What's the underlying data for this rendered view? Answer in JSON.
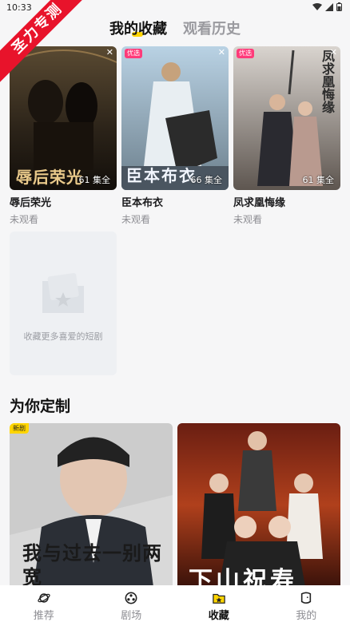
{
  "status": {
    "time": "10:33"
  },
  "ribbon": {
    "text": "圣力专测"
  },
  "tabs": [
    {
      "label": "我的收藏",
      "active": true
    },
    {
      "label": "观看历史",
      "active": false
    }
  ],
  "favorites": [
    {
      "title": "辱后荣光",
      "status": "未观看",
      "episodes": "61 集全",
      "badge": "",
      "poster_text": "辱后荣光"
    },
    {
      "title": "臣本布衣",
      "status": "未观看",
      "episodes": "66 集全",
      "badge": "优选",
      "poster_text": "臣本布衣"
    },
    {
      "title": "凤求凰悔缘",
      "status": "未观看",
      "episodes": "61 集全",
      "badge": "优选",
      "poster_text": "凤求凰悔缘"
    }
  ],
  "empty_slot": {
    "text": "收藏更多喜爱的短剧"
  },
  "section": {
    "title": "为你定制"
  },
  "recommendations": [
    {
      "badge": "新剧",
      "poster_text": "我与过去一别两宽"
    },
    {
      "badge": "",
      "poster_text": "下山祝寿"
    }
  ],
  "bottom_nav": [
    {
      "label": "推荐",
      "icon": "planet-icon",
      "active": false
    },
    {
      "label": "剧场",
      "icon": "film-reel-icon",
      "active": false
    },
    {
      "label": "收藏",
      "icon": "star-folder-icon",
      "active": true
    },
    {
      "label": "我的",
      "icon": "profile-icon",
      "active": false
    }
  ],
  "colors": {
    "accent": "#ffd500",
    "badge_pink": "#ff3b7a",
    "ribbon_red": "#e8132b"
  }
}
